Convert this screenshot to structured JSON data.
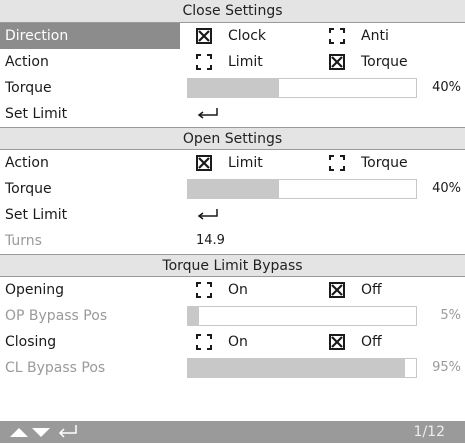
{
  "close_settings": {
    "header": "Close Settings",
    "direction": {
      "label": "Direction",
      "opt1": "Clock",
      "opt1_checked": true,
      "opt2": "Anti",
      "opt2_checked": false
    },
    "action": {
      "label": "Action",
      "opt1": "Limit",
      "opt1_checked": false,
      "opt2": "Torque",
      "opt2_checked": true
    },
    "torque": {
      "label": "Torque",
      "value_pct": 40,
      "value_text": "40%"
    },
    "set_limit": {
      "label": "Set Limit",
      "icon": "enter-icon"
    }
  },
  "open_settings": {
    "header": "Open Settings",
    "action": {
      "label": "Action",
      "opt1": "Limit",
      "opt1_checked": true,
      "opt2": "Torque",
      "opt2_checked": false
    },
    "torque": {
      "label": "Torque",
      "value_pct": 40,
      "value_text": "40%"
    },
    "set_limit": {
      "label": "Set Limit",
      "icon": "enter-icon"
    },
    "turns": {
      "label": "Turns",
      "value": "14.9"
    }
  },
  "torque_limit_bypass": {
    "header": "Torque Limit Bypass",
    "opening": {
      "label": "Opening",
      "opt1": "On",
      "opt1_checked": false,
      "opt2": "Off",
      "opt2_checked": true
    },
    "op_bypass_pos": {
      "label": "OP Bypass Pos",
      "value_pct": 5,
      "value_text": "5%"
    },
    "closing": {
      "label": "Closing",
      "opt1": "On",
      "opt1_checked": false,
      "opt2": "Off",
      "opt2_checked": true
    },
    "cl_bypass_pos": {
      "label": "CL Bypass Pos",
      "value_pct": 95,
      "value_text": "95%"
    }
  },
  "footer": {
    "page": "1/12",
    "icons": [
      "up-arrow-icon",
      "down-arrow-icon",
      "enter-icon"
    ]
  },
  "colors": {
    "selected": "#8c8c8c",
    "header_bg": "#e4e4e4",
    "bar_fill": "#c8c8c8",
    "footer_bg": "#9a9a9a",
    "disabled_text": "#9a9a9a"
  }
}
